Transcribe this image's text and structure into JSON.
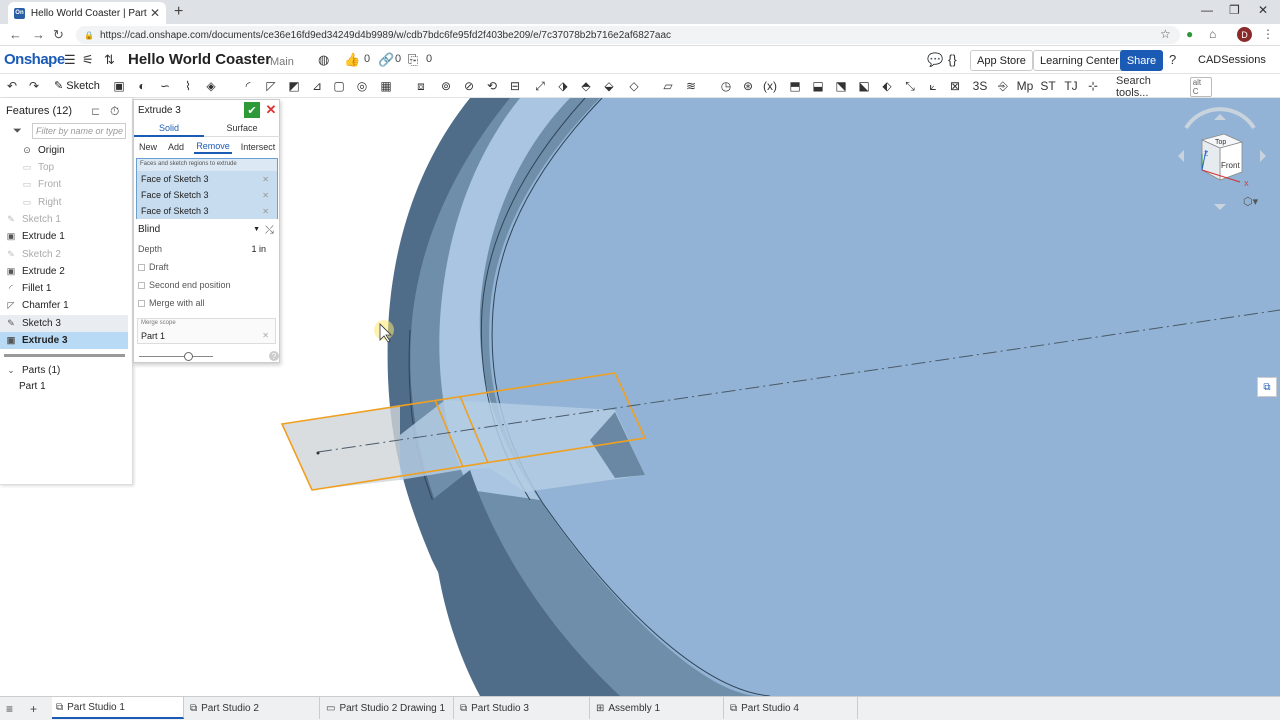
{
  "browser": {
    "tab_title": "Hello World Coaster | Part Studio",
    "favicon": "On",
    "url": "https://cad.onshape.com/documents/ce36e16fd9ed34249d4b9989/w/cdb7bdc6fe95fd2f403be209/e/7c37078b2b716e2af6827aac",
    "avatar_letter": "D"
  },
  "header": {
    "logo": "Onshape",
    "doc_title": "Hello World Coaster",
    "branch": "Main",
    "likes": "0",
    "links": "0",
    "copies": "0",
    "app_store": "App Store",
    "learning_center": "Learning Center",
    "share": "Share",
    "user": "CADSessions"
  },
  "toolbar": {
    "sketch": "Sketch",
    "search_tools": "Search tools...",
    "search_kbd": "alt C"
  },
  "features": {
    "header": "Features (12)",
    "filter_placeholder": "Filter by name or type",
    "items": [
      {
        "label": "Origin",
        "icon": "origin-icon"
      },
      {
        "label": "Top",
        "icon": "plane-icon"
      },
      {
        "label": "Front",
        "icon": "plane-icon"
      },
      {
        "label": "Right",
        "icon": "plane-icon"
      },
      {
        "label": "Sketch 1",
        "icon": "sketch-icon"
      },
      {
        "label": "Extrude 1",
        "icon": "extrude-icon"
      },
      {
        "label": "Sketch 2",
        "icon": "sketch-icon"
      },
      {
        "label": "Extrude 2",
        "icon": "extrude-icon"
      },
      {
        "label": "Fillet 1",
        "icon": "fillet-icon"
      },
      {
        "label": "Chamfer 1",
        "icon": "chamfer-icon"
      },
      {
        "label": "Sketch 3",
        "icon": "sketch-icon"
      },
      {
        "label": "Extrude 3",
        "icon": "extrude-icon"
      }
    ],
    "parts_header": "Parts (1)",
    "part": "Part 1"
  },
  "dialog": {
    "title": "Extrude 3",
    "solid": "Solid",
    "surface": "Surface",
    "new": "New",
    "add": "Add",
    "remove": "Remove",
    "intersect": "Intersect",
    "query_label": "Faces and sketch regions to extrude",
    "queries": [
      "Face of Sketch 3",
      "Face of Sketch 3",
      "Face of Sketch 3"
    ],
    "end_type": "Blind",
    "depth_label": "Depth",
    "depth_value": "1 in",
    "draft": "Draft",
    "second_end": "Second end position",
    "merge_all": "Merge with all",
    "merge_scope_label": "Merge scope",
    "merge_scope_value": "Part 1"
  },
  "viewcube": {
    "top": "Top",
    "front": "Front",
    "axis_z": "Z",
    "axis_x": "X"
  },
  "bottom_tabs": [
    {
      "label": "Part Studio 1",
      "active": true
    },
    {
      "label": "Part Studio 2",
      "active": false
    },
    {
      "label": "Part Studio 2 Drawing 1",
      "active": false
    },
    {
      "label": "Part Studio 3",
      "active": false
    },
    {
      "label": "Assembly 1",
      "active": false
    },
    {
      "label": "Part Studio 4",
      "active": false
    }
  ],
  "colors": {
    "brand": "#1c5bb5",
    "model_face": "#8fb1d6",
    "model_dark": "#5a7893",
    "sketch_outline": "#f0a020",
    "selection": "#b9daf4"
  }
}
